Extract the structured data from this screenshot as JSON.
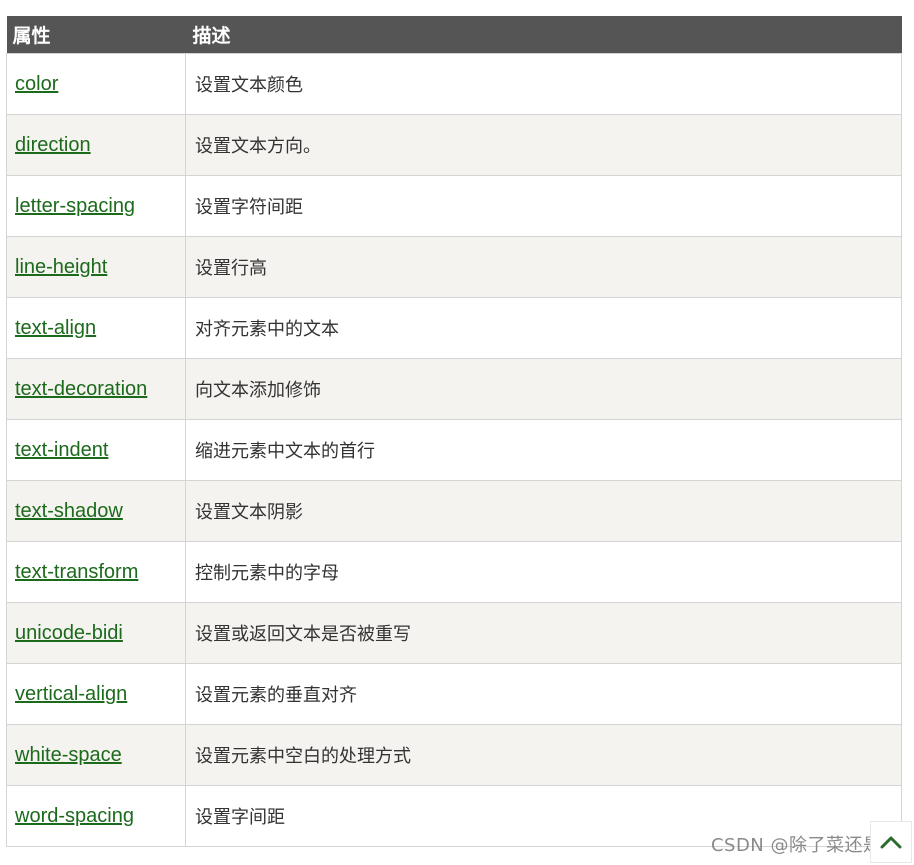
{
  "table": {
    "headers": [
      "属性",
      "描述"
    ],
    "rows": [
      {
        "property": "color",
        "description": "设置文本颜色"
      },
      {
        "property": "direction",
        "description": "设置文本方向。"
      },
      {
        "property": "letter-spacing",
        "description": "设置字符间距"
      },
      {
        "property": "line-height",
        "description": "设置行高"
      },
      {
        "property": "text-align",
        "description": "对齐元素中的文本"
      },
      {
        "property": "text-decoration",
        "description": "向文本添加修饰"
      },
      {
        "property": "text-indent",
        "description": "缩进元素中文本的首行"
      },
      {
        "property": "text-shadow",
        "description": "设置文本阴影"
      },
      {
        "property": "text-transform",
        "description": "控制元素中的字母"
      },
      {
        "property": "unicode-bidi",
        "description": "设置或返回文本是否被重写"
      },
      {
        "property": "vertical-align",
        "description": "设置元素的垂直对齐"
      },
      {
        "property": "white-space",
        "description": "设置元素中空白的处理方式"
      },
      {
        "property": "word-spacing",
        "description": "设置字间距"
      }
    ]
  },
  "watermark": "CSDN @除了菜还是菜",
  "back_to_top": {
    "icon": "chevron-up-icon"
  },
  "colors": {
    "header_bg": "#555555",
    "link": "#1c6a1c",
    "alt_row_bg": "#f4f3ef",
    "border": "#d4d4d4"
  }
}
